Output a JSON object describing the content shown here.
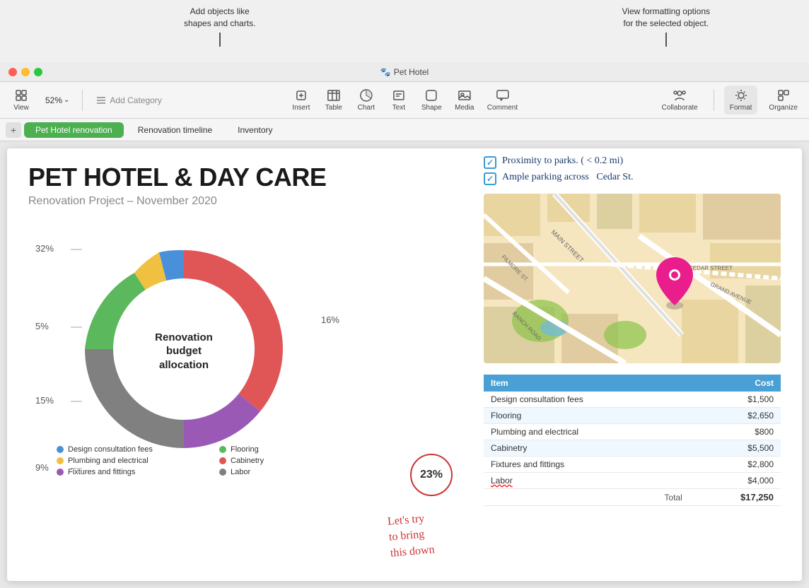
{
  "tooltips": {
    "left": {
      "line1": "Add objects like",
      "line2": "shapes and charts."
    },
    "right": {
      "line1": "View formatting options",
      "line2": "for the selected object."
    }
  },
  "titlebar": {
    "icon": "🐾",
    "title": "Pet Hotel"
  },
  "toolbar": {
    "view_label": "View",
    "zoom_value": "52%",
    "zoom_chevron": "⌄",
    "add_category_label": "Add Category",
    "insert_label": "Insert",
    "table_label": "Table",
    "chart_label": "Chart",
    "text_label": "Text",
    "shape_label": "Shape",
    "media_label": "Media",
    "comment_label": "Comment",
    "collaborate_label": "Collaborate",
    "format_label": "Format",
    "organize_label": "Organize"
  },
  "tabs": {
    "add_label": "+",
    "tab1": "Pet Hotel renovation",
    "tab2": "Renovation timeline",
    "tab3": "Inventory"
  },
  "document": {
    "title": "PET HOTEL & DAY CARE",
    "subtitle": "Renovation Project – November 2020",
    "chart_center_label": "Renovation budget\nallocation",
    "percentages_left": [
      "32%",
      "5%",
      "15%",
      "9%"
    ],
    "percentages_right": [
      "16%",
      "23%"
    ],
    "checklist": [
      "Proximity to parks. ( < 0.2 mi)",
      "Ample parking across  Cedar St."
    ],
    "annotation_circle_text": "23%",
    "handwritten_note": "Let's try\nto bring\nthis down"
  },
  "legend": {
    "items": [
      {
        "label": "Design consultation fees",
        "color": "#4a90d9"
      },
      {
        "label": "Flooring",
        "color": "#5cb85c"
      },
      {
        "label": "Plumbing and electrical",
        "color": "#f0c040"
      },
      {
        "label": "Cabinetry",
        "color": "#e05555"
      },
      {
        "label": "Fixtures and fittings",
        "color": "#9b59b6"
      },
      {
        "label": "Labor",
        "color": "#808080"
      }
    ]
  },
  "chart": {
    "segments": [
      {
        "label": "Design consultation fees",
        "value": 9,
        "color": "#4a90d9",
        "startAngle": 0
      },
      {
        "label": "Flooring",
        "value": 15,
        "color": "#5cb85c",
        "startAngle": 32.4
      },
      {
        "label": "Plumbing and electrical",
        "value": 5,
        "color": "#f0c040",
        "startAngle": 86.4
      },
      {
        "label": "Cabinetry",
        "value": 32,
        "color": "#e05555",
        "startAngle": 104.4
      },
      {
        "label": "Fixtures and fittings",
        "value": 16,
        "color": "#9b59b6",
        "startAngle": 219.6
      },
      {
        "label": "Labor",
        "value": 23,
        "color": "#808080",
        "startAngle": 278.4
      }
    ]
  },
  "table": {
    "headers": [
      "Item",
      "Cost"
    ],
    "rows": [
      {
        "item": "Design consultation fees",
        "cost": "$1,500",
        "alt": false
      },
      {
        "item": "Flooring",
        "cost": "$2,650",
        "alt": true
      },
      {
        "item": "Plumbing and electrical",
        "cost": "$800",
        "alt": false
      },
      {
        "item": "Cabinetry",
        "cost": "$5,500",
        "alt": true
      },
      {
        "item": "Fixtures and fittings",
        "cost": "$2,800",
        "alt": false
      },
      {
        "item": "Labor",
        "cost": "$4,000",
        "alt": true,
        "underline": true
      }
    ],
    "total_label": "Total",
    "total_value": "$17,250"
  }
}
